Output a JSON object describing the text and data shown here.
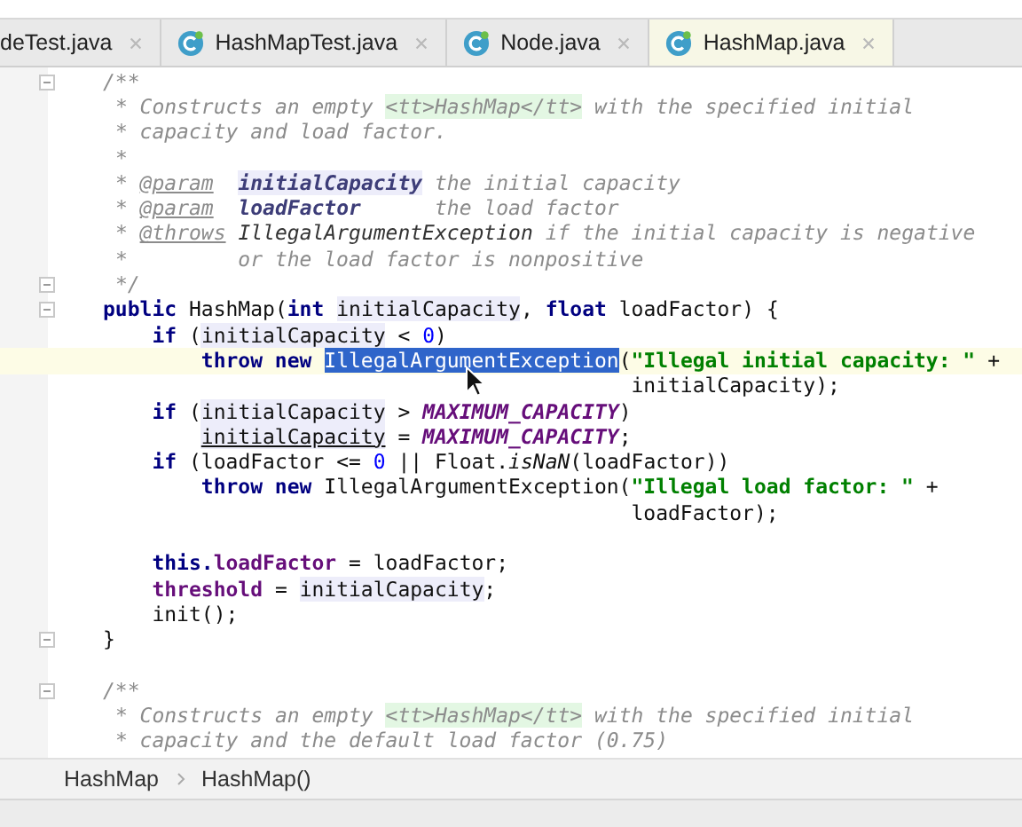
{
  "tabs": [
    {
      "label": "deTest.java",
      "icon": false,
      "selected": false
    },
    {
      "label": "HashMapTest.java",
      "icon": true,
      "selected": false
    },
    {
      "label": "Node.java",
      "icon": true,
      "selected": false
    },
    {
      "label": "HashMap.java",
      "icon": true,
      "selected": true
    }
  ],
  "editor": {
    "lines": [
      {
        "fold": true,
        "current": false,
        "tokens": [
          {
            "t": "/**",
            "kind": "cm"
          }
        ]
      },
      {
        "fold": false,
        "current": false,
        "tokens": [
          {
            "t": " * Constructs an empty ",
            "kind": "cm"
          },
          {
            "t": "<tt>HashMap</tt>",
            "kind": "tt"
          },
          {
            "t": " with the specified initial",
            "kind": "cm"
          }
        ]
      },
      {
        "fold": false,
        "current": false,
        "tokens": [
          {
            "t": " * capacity and load factor.",
            "kind": "cm"
          }
        ]
      },
      {
        "fold": false,
        "current": false,
        "tokens": [
          {
            "t": " *",
            "kind": "cm"
          }
        ]
      },
      {
        "fold": false,
        "current": false,
        "tokens": [
          {
            "t": " * ",
            "kind": "cm"
          },
          {
            "t": "@param",
            "kind": "tag"
          },
          {
            "t": "  initialCapacity",
            "kind": "docparam-usage"
          },
          {
            "t": " the initial capacity",
            "kind": "cm"
          }
        ]
      },
      {
        "fold": false,
        "current": false,
        "tokens": [
          {
            "t": " * ",
            "kind": "cm"
          },
          {
            "t": "@param",
            "kind": "tag"
          },
          {
            "t": "  loadFactor",
            "kind": "docparam"
          },
          {
            "t": "      the load factor",
            "kind": "cm"
          }
        ]
      },
      {
        "fold": false,
        "current": false,
        "tokens": [
          {
            "t": " * ",
            "kind": "cm"
          },
          {
            "t": "@throws",
            "kind": "tag"
          },
          {
            "t": " IllegalArgumentException",
            "kind": "docref"
          },
          {
            "t": " if the initial capacity is negative",
            "kind": "cm"
          }
        ]
      },
      {
        "fold": false,
        "current": false,
        "tokens": [
          {
            "t": " *         or the load factor is nonpositive",
            "kind": "cm"
          }
        ]
      },
      {
        "fold": true,
        "current": false,
        "tokens": [
          {
            "t": " */",
            "kind": "cm"
          }
        ]
      },
      {
        "fold": true,
        "current": false,
        "tokens": [
          {
            "t": "public",
            "kind": "kw"
          },
          {
            "t": " HashMap(",
            "kind": "plain"
          },
          {
            "t": "int",
            "kind": "kw"
          },
          {
            "t": " initialCapacity",
            "kind": "usage"
          },
          {
            "t": ", ",
            "kind": "plain"
          },
          {
            "t": "float",
            "kind": "kw"
          },
          {
            "t": " loadFactor) {",
            "kind": "plain"
          }
        ]
      },
      {
        "fold": false,
        "current": false,
        "tokens": [
          {
            "t": "    if",
            "kind": "kw"
          },
          {
            "t": " (",
            "kind": "plain"
          },
          {
            "t": "initialCapacity",
            "kind": "usage"
          },
          {
            "t": " < ",
            "kind": "plain"
          },
          {
            "t": "0",
            "kind": "num"
          },
          {
            "t": ")",
            "kind": "plain"
          }
        ]
      },
      {
        "fold": false,
        "current": true,
        "tokens": [
          {
            "t": "        throw new",
            "kind": "kw"
          },
          {
            "t": " IllegalArgumentException",
            "kind": "sel"
          },
          {
            "t": "(",
            "kind": "plain"
          },
          {
            "t": "\"Illegal initial capacity: \"",
            "kind": "str"
          },
          {
            "t": " +",
            "kind": "plain"
          }
        ]
      },
      {
        "fold": false,
        "current": false,
        "tokens": [
          {
            "t": "                                           initialCapacity);",
            "kind": "plain"
          }
        ]
      },
      {
        "fold": false,
        "current": false,
        "tokens": [
          {
            "t": "    if",
            "kind": "kw"
          },
          {
            "t": " (",
            "kind": "plain"
          },
          {
            "t": "initialCapacity",
            "kind": "usage"
          },
          {
            "t": " > ",
            "kind": "plain"
          },
          {
            "t": "MAXIMUM_CAPACITY",
            "kind": "const"
          },
          {
            "t": ")",
            "kind": "plain"
          }
        ]
      },
      {
        "fold": false,
        "current": false,
        "tokens": [
          {
            "t": "        initialCapacity",
            "kind": "usage-assigned"
          },
          {
            "t": " = ",
            "kind": "plain"
          },
          {
            "t": "MAXIMUM_CAPACITY",
            "kind": "const"
          },
          {
            "t": ";",
            "kind": "plain"
          }
        ]
      },
      {
        "fold": false,
        "current": false,
        "tokens": [
          {
            "t": "    if",
            "kind": "kw"
          },
          {
            "t": " (loadFactor <= ",
            "kind": "plain"
          },
          {
            "t": "0",
            "kind": "num"
          },
          {
            "t": " || Float.",
            "kind": "plain"
          },
          {
            "t": "isNaN",
            "kind": "static"
          },
          {
            "t": "(loadFactor))",
            "kind": "plain"
          }
        ]
      },
      {
        "fold": false,
        "current": false,
        "tokens": [
          {
            "t": "        throw new",
            "kind": "kw"
          },
          {
            "t": " IllegalArgumentException(",
            "kind": "plain"
          },
          {
            "t": "\"Illegal load factor: \"",
            "kind": "str"
          },
          {
            "t": " +",
            "kind": "plain"
          }
        ]
      },
      {
        "fold": false,
        "current": false,
        "tokens": [
          {
            "t": "                                           loadFactor);",
            "kind": "plain"
          }
        ]
      },
      {
        "fold": false,
        "current": false
      },
      {
        "fold": false,
        "current": false,
        "tokens": [
          {
            "t": "    this.",
            "kind": "kw"
          },
          {
            "t": "loadFactor",
            "kind": "field"
          },
          {
            "t": " = loadFactor;",
            "kind": "plain"
          }
        ]
      },
      {
        "fold": false,
        "current": false,
        "tokens": [
          {
            "t": "    threshold",
            "kind": "field"
          },
          {
            "t": " = ",
            "kind": "plain"
          },
          {
            "t": "initialCapacity",
            "kind": "usage"
          },
          {
            "t": ";",
            "kind": "plain"
          }
        ]
      },
      {
        "fold": false,
        "current": false,
        "tokens": [
          {
            "t": "    init();",
            "kind": "plain"
          }
        ]
      },
      {
        "fold": true,
        "current": false,
        "tokens": [
          {
            "t": "}",
            "kind": "plain"
          }
        ]
      },
      {
        "fold": false,
        "current": false
      },
      {
        "fold": true,
        "current": false,
        "tokens": [
          {
            "t": "/**",
            "kind": "cm"
          }
        ]
      },
      {
        "fold": false,
        "current": false,
        "tokens": [
          {
            "t": " * Constructs an empty ",
            "kind": "cm"
          },
          {
            "t": "<tt>HashMap</tt>",
            "kind": "tt"
          },
          {
            "t": " with the specified initial",
            "kind": "cm"
          }
        ]
      },
      {
        "fold": false,
        "current": false,
        "tokens": [
          {
            "t": " * capacity and the default load factor (0.75)",
            "kind": "cm"
          }
        ]
      }
    ]
  },
  "breadcrumb": [
    "HashMap",
    "HashMap()"
  ]
}
